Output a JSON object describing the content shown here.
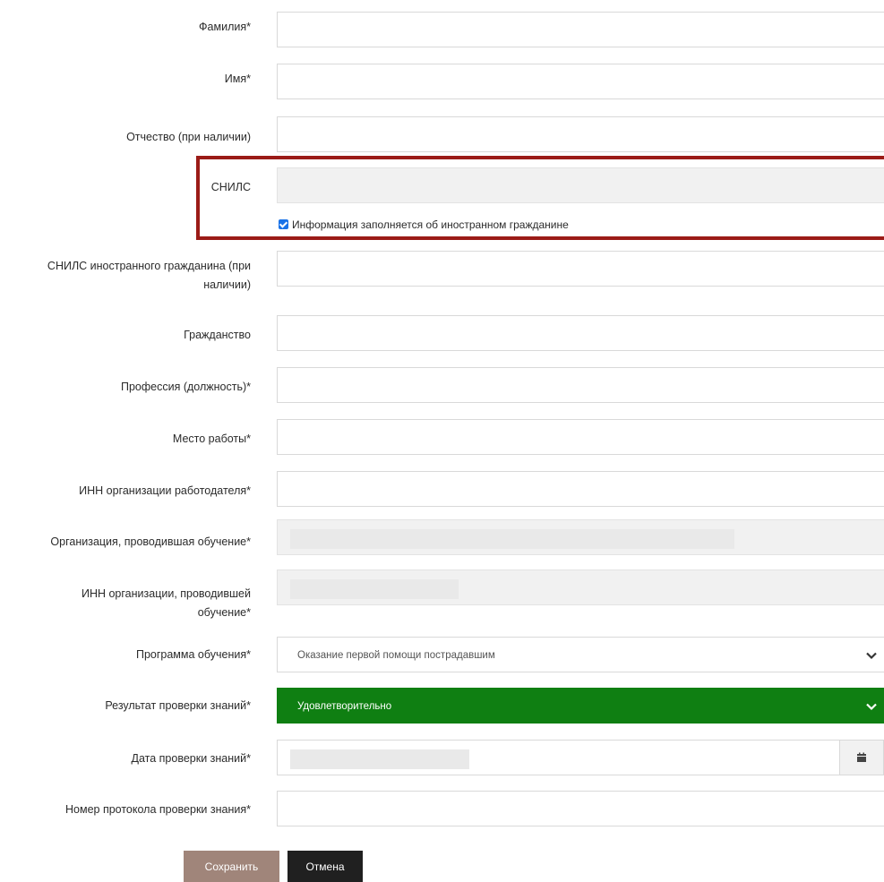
{
  "fields": {
    "surname": {
      "label": "Фамилия*"
    },
    "name": {
      "label": "Имя*"
    },
    "patronymic": {
      "label": "Отчество (при наличии)"
    },
    "snils": {
      "label": "СНИЛС"
    },
    "foreign_checkbox": {
      "label": "Информация заполняется об иностранном гражданине",
      "checked": true
    },
    "foreign_snils": {
      "label_line1": "СНИЛС иностранного гражданина (при",
      "label_line2": "наличии)"
    },
    "citizenship": {
      "label": "Гражданство"
    },
    "profession": {
      "label": "Профессия (должность)*"
    },
    "workplace": {
      "label": "Место работы*"
    },
    "employer_inn": {
      "label": "ИНН организации работодателя*"
    },
    "training_org": {
      "label": "Организация, проводившая обучение*"
    },
    "training_org_inn": {
      "label_line1": "ИНН организации, проводившей",
      "label_line2": "обучение*"
    },
    "program": {
      "label": "Программа обучения*",
      "value": "Оказание первой помощи пострадавшим"
    },
    "result": {
      "label": "Результат проверки знаний*",
      "value": "Удовлетворительно"
    },
    "check_date": {
      "label": "Дата проверки знаний*"
    },
    "protocol_number": {
      "label": "Номер протокола проверки знания*"
    }
  },
  "buttons": {
    "save": "Сохранить",
    "cancel": "Отмена"
  },
  "colors": {
    "highlight": "#9b1b17",
    "result_green": "#0f7f12",
    "save_button": "#a0857a",
    "cancel_button": "#202020"
  },
  "icons": {
    "select_arrow": "chevron-down-icon",
    "date_picker": "calendar-icon"
  }
}
